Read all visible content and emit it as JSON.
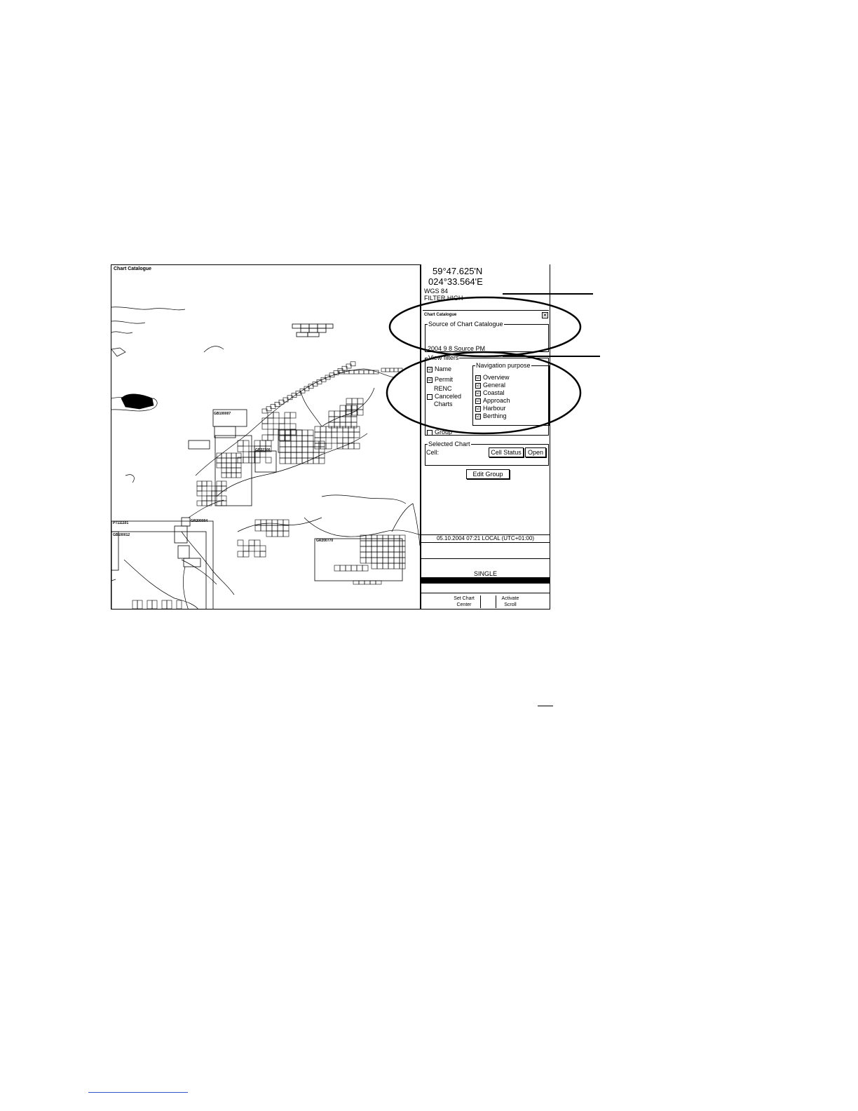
{
  "map": {
    "title": "Chart Catalogue",
    "cell_labels": [
      "GB100007",
      "GB32100",
      "PT111101",
      "GB100012",
      "GR200004",
      "GR200770"
    ]
  },
  "panel": {
    "latitude": "59°47.625'N",
    "longitude": "024°33.564'E",
    "datum": "WGS 84",
    "filter": "FILTER HIGH"
  },
  "dialog": {
    "title": "Chart Catalogue",
    "close_icon": "✕",
    "source_group": {
      "legend": "Source of Chart Catalogue",
      "value": "2004  9  8 Source PM"
    },
    "view_filters": {
      "legend": "View filters",
      "items": [
        {
          "label": "Name",
          "checked": "☑"
        },
        {
          "label": "Permit",
          "checked": "☑"
        },
        {
          "label": "RENC",
          "checked": ""
        },
        {
          "label": "Canceled",
          "checked": "☐"
        },
        {
          "label": "Charts",
          "checked": ""
        }
      ],
      "group_label": "Group"
    },
    "navigation_purpose": {
      "legend": "Navigation purpose",
      "items": [
        "Overview",
        "General",
        "Coastal",
        "Approach",
        "Harbour",
        "Berthing"
      ]
    },
    "selected_chart": {
      "legend": "Selected Chart",
      "cell_label": "Cell:",
      "cell_status_button": "Cell Status",
      "open_button": "Open"
    },
    "edit_group_button": "Edit Group"
  },
  "status": {
    "datetime": "05.10.2004 07:21 LOCAL (UTC+01:00)",
    "mode": "SINGLE"
  },
  "softkeys": {
    "set_chart_center_1": "Set Chart",
    "set_chart_center_2": "Center",
    "activate_scroll_1": "Activate",
    "activate_scroll_2": "Scroll"
  },
  "colors": {
    "foreground": "#000000",
    "background": "#ffffff",
    "footer_rule": "#3355cc"
  }
}
